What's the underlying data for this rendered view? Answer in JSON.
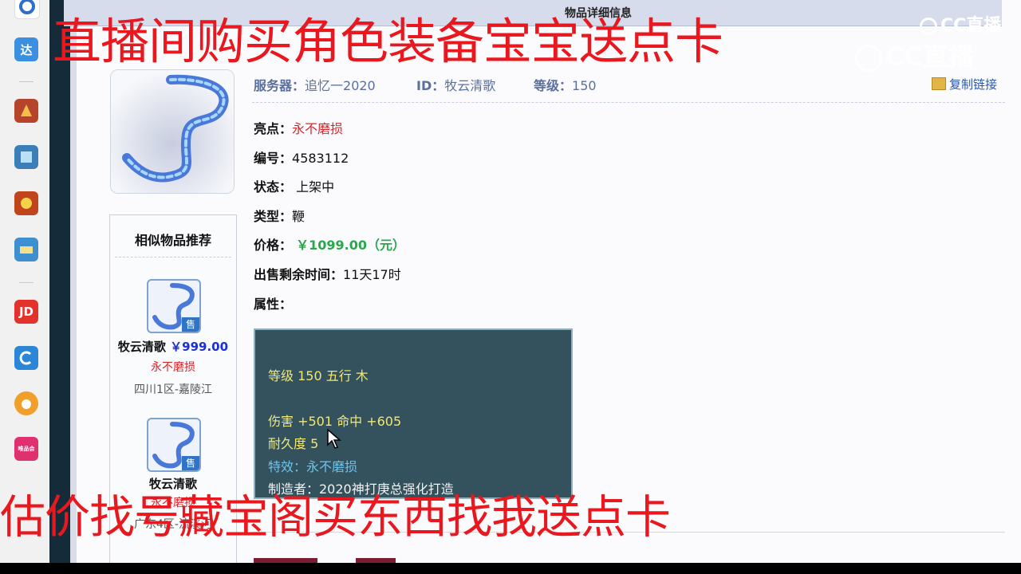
{
  "page": {
    "title": "物品详细信息"
  },
  "header": {
    "server_label": "服务器：",
    "server_value": "追忆一2020",
    "id_label": "ID：",
    "id_value": "牧云清歌",
    "level_label": "等级：",
    "level_value": "150",
    "copy_link": "复制链接"
  },
  "fields": {
    "highlight_label": "亮点：",
    "highlight_value": "永不磨损",
    "number_label": "编号：",
    "number_value": "4583112",
    "status_label": "状态：",
    "status_value": "上架中",
    "type_label": "类型：",
    "type_value": "鞭",
    "price_label": "价格：",
    "price_value": "￥1099.00（元）",
    "remaining_label": "出售剩余时间：",
    "remaining_value": "11天17时",
    "attributes_label": "属性："
  },
  "attributes": {
    "line1": "等级 150 五行 木",
    "line2": "伤害 +501 命中 +605",
    "line3": "耐久度 5",
    "line4": "特效：永不磨损",
    "line5": "制造者：2020神打庚总强化打造"
  },
  "similar": {
    "title": "相似物品推荐",
    "items": [
      {
        "name": "牧云清歌",
        "price": "￥999.00",
        "tag": "永不磨损",
        "server": "四川1区-嘉陵江",
        "badge": "售"
      },
      {
        "name": "牧云清歌",
        "price": "",
        "tag": "永不磨损",
        "server": "广东4区-流溪河",
        "badge": "售"
      }
    ]
  },
  "dock": {
    "items": [
      {
        "icon": "cc-icon",
        "label": "",
        "color": "#2f6fc6"
      },
      {
        "icon": "da-icon",
        "label": "达",
        "color": "#3a8fe0"
      },
      {
        "icon": "game-icon-1",
        "label": "",
        "color": "#b5442b"
      },
      {
        "icon": "game-icon-2",
        "label": "",
        "color": "#3c7fb8"
      },
      {
        "icon": "game-icon-3",
        "label": "",
        "color": "#c0451d"
      },
      {
        "icon": "game-icon-4",
        "label": "",
        "color": "#3d8fcf"
      },
      {
        "icon": "jd-icon",
        "label": "JD",
        "color": "#e3322b"
      },
      {
        "icon": "cc-live-icon",
        "label": "",
        "color": "#2b86d8"
      },
      {
        "icon": "pet-icon",
        "label": "",
        "color": "#f0a02a"
      },
      {
        "icon": "shop-icon",
        "label": "唯品会",
        "color": "#e0316f"
      }
    ]
  },
  "overlays": {
    "top_text": "直播间购买角色装备宝宝送点卡",
    "bottom_text": "估价找号藏宝阁买东西找我送点卡",
    "watermark_small": "CC直播",
    "watermark_large": "CC直播"
  },
  "colors": {
    "overlay_red": "#e8181e",
    "price_green": "#27a84a",
    "attr_bg": "#33525e",
    "attr_yellow": "#f1e773",
    "attr_cyan": "#6fc3ea"
  }
}
